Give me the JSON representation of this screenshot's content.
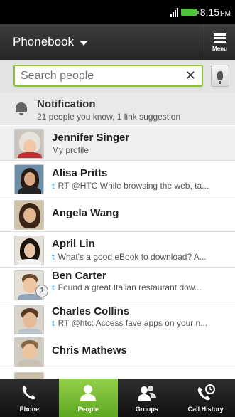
{
  "status": {
    "time": "8:15",
    "ampm": "PM"
  },
  "header": {
    "title": "Phonebook",
    "menu_label": "Menu"
  },
  "search": {
    "placeholder": "Search people"
  },
  "notification": {
    "title": "Notification",
    "subtitle": "21 people you know, 1 link suggestion"
  },
  "contacts": [
    {
      "name": "Jennifer Singer",
      "sub": "My profile",
      "twitter": false
    },
    {
      "name": "Alisa Pritts",
      "sub": "RT @HTC While browsing the web, ta...",
      "twitter": true
    },
    {
      "name": "Angela Wang",
      "sub": "",
      "twitter": false
    },
    {
      "name": "April Lin",
      "sub": "What's a good eBook to download? A...",
      "twitter": true
    },
    {
      "name": "Ben Carter",
      "sub": "Found a great Italian restaurant dow...",
      "twitter": true,
      "badge": "1"
    },
    {
      "name": "Charles Collins",
      "sub": "RT @htc: Access fave apps on your n...",
      "twitter": true
    },
    {
      "name": "Chris Mathews",
      "sub": "",
      "twitter": false
    }
  ],
  "tabs": [
    {
      "label": "Phone"
    },
    {
      "label": "People"
    },
    {
      "label": "Groups"
    },
    {
      "label": "Call History"
    }
  ],
  "colors": {
    "accent": "#8ac33a",
    "active_tab": "#6fb82b",
    "twitter": "#3ba9e8"
  }
}
